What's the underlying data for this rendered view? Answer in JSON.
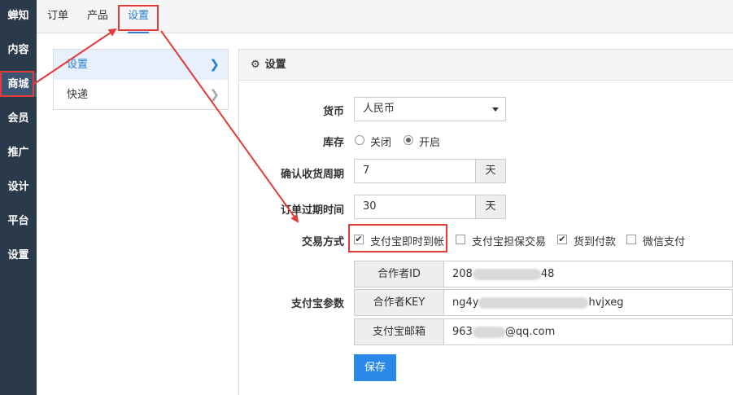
{
  "sidebar": {
    "items": [
      {
        "label": "蝉知"
      },
      {
        "label": "内容"
      },
      {
        "label": "商城"
      },
      {
        "label": "会员"
      },
      {
        "label": "推广"
      },
      {
        "label": "设计"
      },
      {
        "label": "平台"
      },
      {
        "label": "设置"
      }
    ]
  },
  "topnav": {
    "tabs": [
      {
        "label": "订单"
      },
      {
        "label": "产品"
      },
      {
        "label": "设置"
      }
    ]
  },
  "submenu": {
    "items": [
      {
        "label": "设置"
      },
      {
        "label": "快递"
      }
    ]
  },
  "panel": {
    "title": "设置",
    "currency": {
      "label": "货币",
      "value": "人民币"
    },
    "stock": {
      "label": "库存",
      "off": "关闭",
      "on": "开启",
      "selected": "开启"
    },
    "confirm_period": {
      "label": "确认收货周期",
      "value": "7",
      "unit": "天"
    },
    "expire": {
      "label": "订单过期时间",
      "value": "30",
      "unit": "天"
    },
    "payment": {
      "label": "交易方式",
      "options": [
        {
          "label": "支付宝即时到帐",
          "checked": true
        },
        {
          "label": "支付宝担保交易",
          "checked": false
        },
        {
          "label": "货到付款",
          "checked": true
        },
        {
          "label": "微信支付",
          "checked": false
        }
      ]
    },
    "alipay": {
      "label": "支付宝参数",
      "partner_id": {
        "label": "合作者ID",
        "prefix": "208",
        "suffix": "48"
      },
      "partner_key": {
        "label": "合作者KEY",
        "prefix": "ng4y",
        "suffix": "hvjxeg"
      },
      "email": {
        "label": "支付宝邮箱",
        "prefix": "963",
        "suffix": "@qq.com"
      }
    },
    "save_label": "保存"
  },
  "colors": {
    "accent": "#2a7fd4",
    "sidebar": "#2b3a4a",
    "annotation": "#e23b3b"
  }
}
